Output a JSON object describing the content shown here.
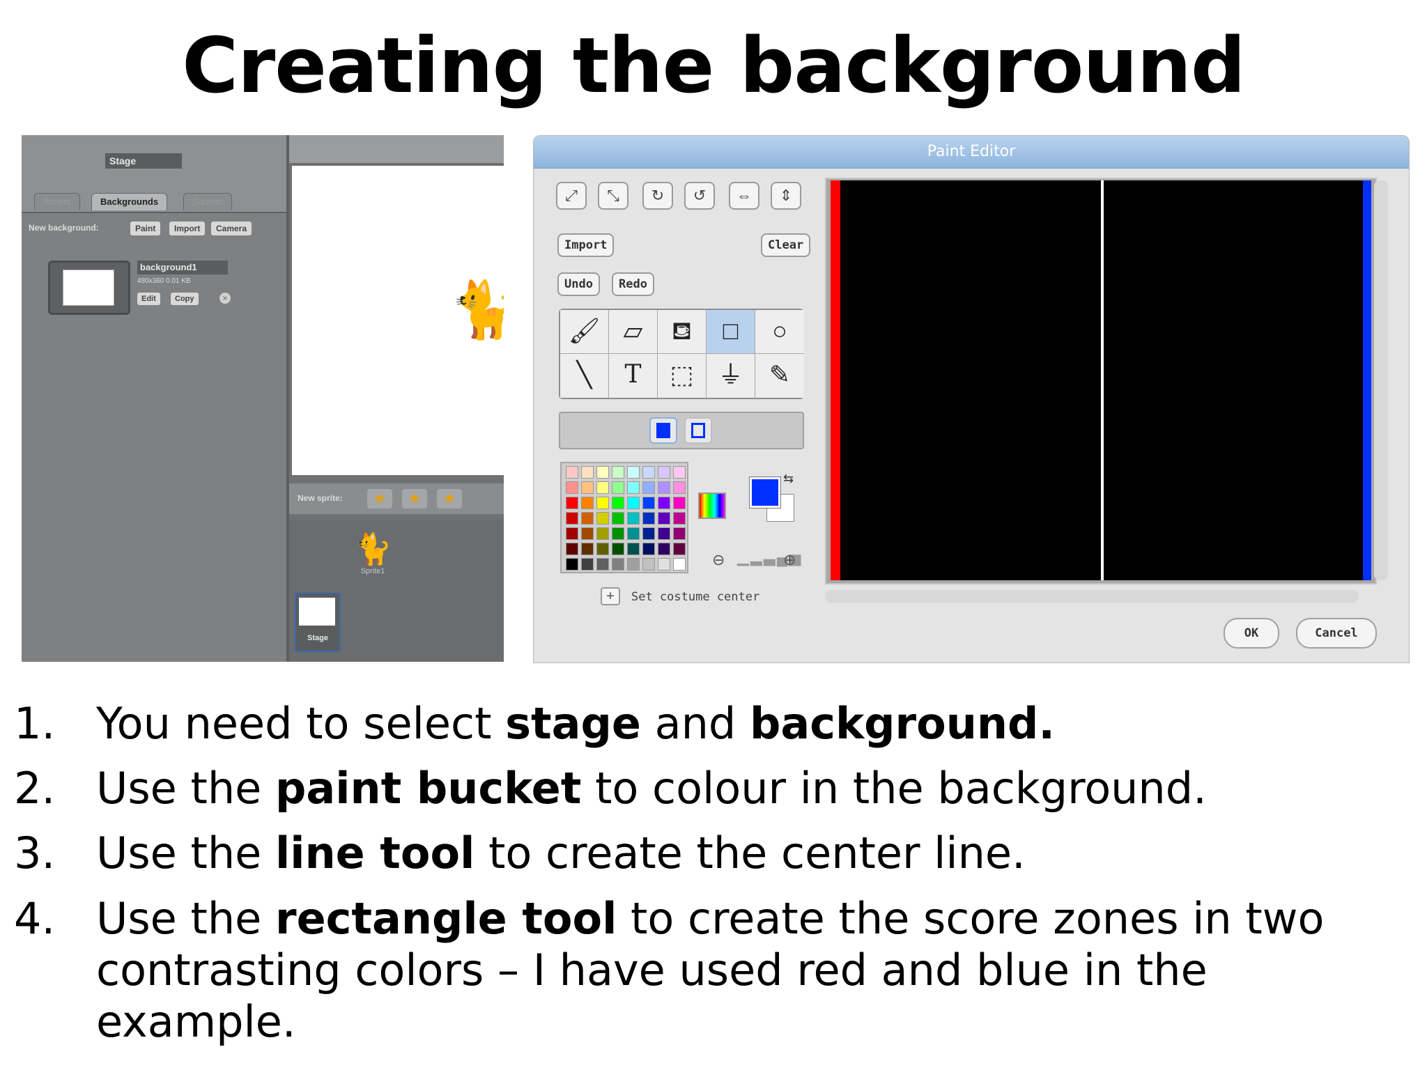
{
  "title": "Creating the background",
  "left_screenshot": {
    "stage_label": "Stage",
    "tabs": [
      "Scripts",
      "Backgrounds",
      "Sounds"
    ],
    "new_background_label": "New background:",
    "new_background_buttons": [
      "Paint",
      "Import",
      "Camera"
    ],
    "background_name": "background1",
    "background_size": "480x360   0.01 KB",
    "background_buttons": [
      "Edit",
      "Copy"
    ],
    "new_sprite_label": "New sprite:",
    "sprite_name": "Sprite1",
    "stage_thumb_label": "Stage"
  },
  "paint_editor": {
    "title": "Paint Editor",
    "import_label": "Import",
    "clear_label": "Clear",
    "undo_label": "Undo",
    "redo_label": "Redo",
    "set_costume_center_label": "Set costume center",
    "ok_label": "OK",
    "cancel_label": "Cancel",
    "selected_tool": "rectangle",
    "foreground_color": "#0030ff",
    "background_color": "#ffffff",
    "canvas_color": "#000000",
    "left_zone_color": "#ff0000",
    "right_zone_color": "#0030ff",
    "center_line_color": "#ffffff",
    "palette": [
      [
        "#ffc8c8",
        "#ffe0c0",
        "#ffffc0",
        "#c8ffc8",
        "#c8ffff",
        "#c8d8ff",
        "#d8c8ff",
        "#ffc8f0"
      ],
      [
        "#ff9090",
        "#ffc080",
        "#ffff80",
        "#90ff90",
        "#80ffff",
        "#90b0ff",
        "#b090ff",
        "#ff90e0"
      ],
      [
        "#ff0000",
        "#ff8000",
        "#ffff00",
        "#00ff00",
        "#00ffff",
        "#0040ff",
        "#8000ff",
        "#ff00c0"
      ],
      [
        "#d00000",
        "#d06000",
        "#d0d000",
        "#00c000",
        "#00c0c0",
        "#0030c0",
        "#6000c0",
        "#c00090"
      ],
      [
        "#a00000",
        "#a04800",
        "#a0a000",
        "#009000",
        "#009090",
        "#002090",
        "#400090",
        "#900070"
      ],
      [
        "#600000",
        "#603000",
        "#606000",
        "#005000",
        "#005050",
        "#001060",
        "#300060",
        "#600040"
      ],
      [
        "#000000",
        "#404040",
        "#606060",
        "#808080",
        "#a0a0a0",
        "#c0c0c0",
        "#e0e0e0",
        "#ffffff"
      ]
    ]
  },
  "steps": [
    {
      "num": "1.",
      "parts": [
        {
          "t": "You need to select "
        },
        {
          "b": "stage"
        },
        {
          "t": " and "
        },
        {
          "b": "background."
        }
      ]
    },
    {
      "num": "2.",
      "parts": [
        {
          "t": "Use the "
        },
        {
          "b": "paint bucket"
        },
        {
          "t": " to colour in the background."
        }
      ]
    },
    {
      "num": "3.",
      "parts": [
        {
          "t": "Use the "
        },
        {
          "b": "line tool"
        },
        {
          "t": " to create the center line."
        }
      ]
    },
    {
      "num": "4.",
      "parts": [
        {
          "t": "Use the "
        },
        {
          "b": "rectangle tool"
        },
        {
          "t": " to create the score zones in two contrasting colors – I have used red and blue in the example."
        }
      ]
    }
  ]
}
